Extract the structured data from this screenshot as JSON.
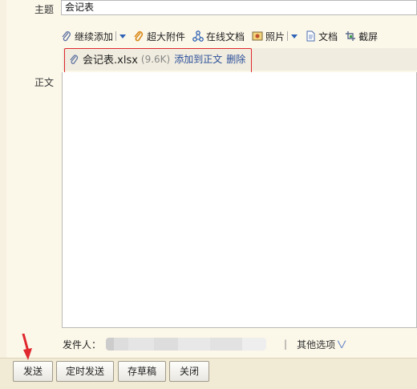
{
  "form": {
    "subject_label": "主题",
    "subject_value": "会记表",
    "body_label": "正文"
  },
  "toolbar": {
    "continue_add": "继续添加",
    "large_attachment": "超大附件",
    "online_doc": "在线文档",
    "photo": "照片",
    "document": "文档",
    "screenshot": "截屏"
  },
  "attachment": {
    "filename": "会记表.xlsx",
    "size": "(9.6K)",
    "add_to_body": "添加到正文",
    "delete": "删除"
  },
  "sender": {
    "label": "发件人：",
    "divider": "|",
    "other_options": "其他选项",
    "options_icon": "chevron-down"
  },
  "actions": {
    "send": "发送",
    "scheduled_send": "定时发送",
    "save_draft": "存草稿",
    "close": "关闭"
  },
  "colors": {
    "highlight": "#e0282e",
    "link": "#2a4e9a",
    "accent_blue": "#2f63b5"
  }
}
